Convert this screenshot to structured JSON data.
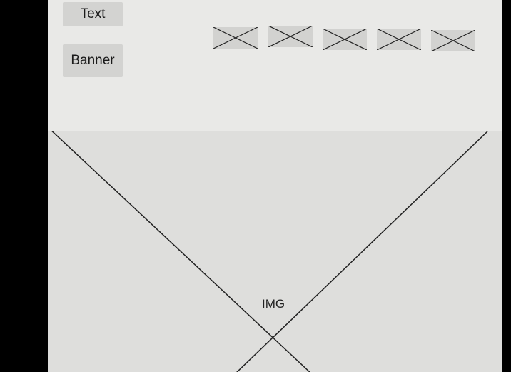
{
  "buttons": {
    "text_label": "Text",
    "banner_label": "Banner"
  },
  "thumbnails": [
    {
      "icon": "placeholder-x-icon"
    },
    {
      "icon": "placeholder-x-icon"
    },
    {
      "icon": "placeholder-x-icon"
    },
    {
      "icon": "placeholder-x-icon"
    },
    {
      "icon": "placeholder-x-icon"
    }
  ],
  "image_placeholder": {
    "label": "IMG"
  },
  "colors": {
    "background": "#000000",
    "panel": "#e6e6e4",
    "pill": "#d3d3d1",
    "line": "#222222"
  }
}
